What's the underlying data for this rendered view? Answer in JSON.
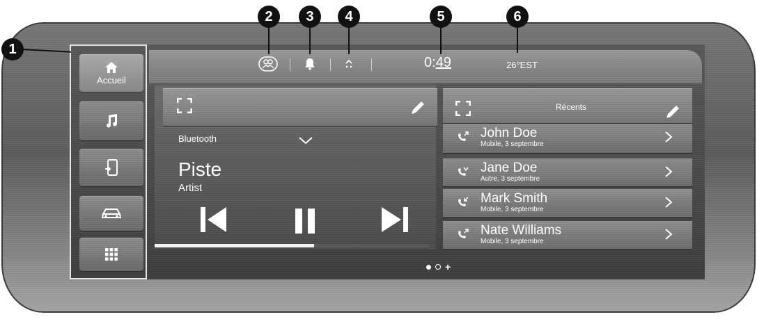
{
  "callouts": [
    "1",
    "2",
    "3",
    "4",
    "5",
    "6"
  ],
  "sidebar": {
    "items": [
      {
        "icon": "home-icon",
        "label": "Accueil",
        "active": true
      },
      {
        "icon": "music-note-icon",
        "label": ""
      },
      {
        "icon": "phone-icon",
        "label": ""
      },
      {
        "icon": "car-icon",
        "label": ""
      },
      {
        "icon": "app-grid-icon",
        "label": ""
      }
    ]
  },
  "status": {
    "profile_icon": "profile-icon",
    "notification_icon": "bell-icon",
    "tray_icon": "tray-expand-icon",
    "time_hours": "0:",
    "time_minutes": "49",
    "temperature": "26°EST"
  },
  "media": {
    "source": "Bluetooth",
    "track": "Piste",
    "artist": "Artist",
    "progress": 0.58
  },
  "calls": {
    "title": "Récents",
    "entries": [
      {
        "name": "John Doe",
        "detail": "Mobile, 3 septembre",
        "direction": "outgoing"
      },
      {
        "name": "Jane Doe",
        "detail": "Autre, 3 septembre",
        "direction": "missed"
      },
      {
        "name": "Mark Smith",
        "detail": "Mobile, 3 septembre",
        "direction": "incoming"
      },
      {
        "name": "Nate Williams",
        "detail": "Mobile, 3 septembre",
        "direction": "outgoing"
      }
    ]
  },
  "pagination": {
    "pages": 2,
    "current": 1,
    "add_label": "+"
  },
  "colors": {
    "text": "#ffffff",
    "callout": "#111111",
    "progress": "#f2f2f2"
  }
}
